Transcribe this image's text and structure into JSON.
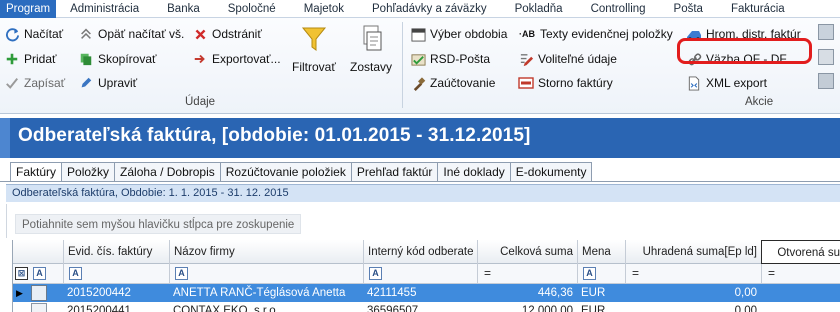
{
  "menu": {
    "tabs": [
      "Program",
      "Administrácia",
      "Banka",
      "Spoločné",
      "Majetok",
      "Pohľadávky a záväzky",
      "Pokladňa",
      "Controlling",
      "Pošta",
      "Fakturácia"
    ]
  },
  "ribbon": {
    "udaje": {
      "label": "Údaje",
      "nacitat": "Načítať",
      "opat_nacitat": "Opäť načítať vš.",
      "odstranit": "Odstrániť",
      "pridat": "Pridať",
      "skopirovat": "Skopírovať",
      "exportovat": "Exportovať...",
      "zapisat": "Zapísať",
      "upravit": "Upraviť",
      "filtrovat": "Filtrovať",
      "zostavy": "Zostavy"
    },
    "akcie": {
      "label": "Akcie",
      "vyber_obdobia": "Výber obdobia",
      "texty": "Texty evidenčnej položky",
      "hrom_distr": "Hrom. distr. faktúr",
      "rsd_posta": "RSD-Pošta",
      "volitelne": "Voliteľné údaje",
      "vazba": "Väzba OF - DF",
      "zauctovanie": "Zaúčtovanie",
      "storno": "Storno faktúry",
      "xml_export": "XML export"
    }
  },
  "window": {
    "title": "Odberateľská faktúra, [obdobie: 01.01.2015 - 31.12.2015]",
    "tabs": [
      "Faktúry",
      "Položky",
      "Záloha / Dobropis",
      "Rozúčtovanie položiek",
      "Prehľad faktúr",
      "Iné doklady",
      "E-dokumenty"
    ],
    "subtitle": "Odberateľská faktúra, Obdobie: 1. 1. 2015 - 31. 12. 2015",
    "group_hint": "Potiahnite sem myšou hlavičku stĺpca pre zoskupenie"
  },
  "grid": {
    "columns": [
      "Evid. čís. faktúry",
      "Názov firmy",
      "Interný kód odberate",
      "Celková suma",
      "Mena",
      "Uhradená suma[Ep ld]",
      "Otvorená su"
    ],
    "rows": [
      [
        "2015200442",
        "ANETTA RANČ-Téglásová Anetta",
        "42111455",
        "446,36",
        "EUR",
        "0,00"
      ],
      [
        "2015200441",
        "CONTAX EKO, s.r.o.",
        "36596507",
        "12 000,00",
        "EUR",
        "0,00"
      ]
    ]
  },
  "colors": {
    "accent": "#2a65b3",
    "selection": "#3f8bdd",
    "highlight": "#e21d1d"
  }
}
